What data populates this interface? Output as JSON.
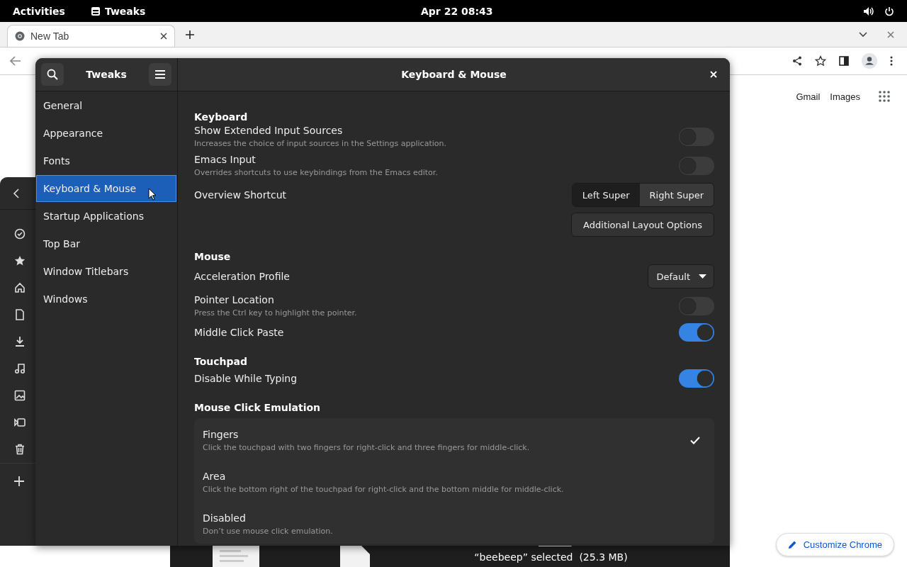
{
  "top_bar": {
    "activities": "Activities",
    "app": "Tweaks",
    "clock": "Apr 22  08:43"
  },
  "browser": {
    "tabs": [
      {
        "label": "New Tab",
        "selected": true
      }
    ],
    "links": [
      "Gmail",
      "Images"
    ],
    "customize": "Customize Chrome"
  },
  "tweaks": {
    "title": "Tweaks",
    "page_title": "Keyboard & Mouse",
    "sidebar": [
      {
        "label": "General",
        "selected": false
      },
      {
        "label": "Appearance",
        "selected": false
      },
      {
        "label": "Fonts",
        "selected": false
      },
      {
        "label": "Keyboard & Mouse",
        "selected": true
      },
      {
        "label": "Startup Applications",
        "selected": false
      },
      {
        "label": "Top Bar",
        "selected": false
      },
      {
        "label": "Window Titlebars",
        "selected": false
      },
      {
        "label": "Windows",
        "selected": false
      }
    ],
    "sections": [
      {
        "heading": "Keyboard",
        "rows": [
          {
            "kind": "switch",
            "label": "Show Extended Input Sources",
            "description": "Increases the choice of input sources in the Settings application.",
            "on": false
          },
          {
            "kind": "switch",
            "label": "Emacs Input",
            "description": "Overrides shortcuts to use keybindings from the Emacs editor.",
            "on": false
          },
          {
            "kind": "segmented",
            "label": "Overview Shortcut",
            "options": [
              {
                "label": "Left Super",
                "selected": true
              },
              {
                "label": "Right Super",
                "selected": false
              }
            ]
          },
          {
            "kind": "button",
            "label": "Additional Layout Options"
          }
        ]
      },
      {
        "heading": "Mouse",
        "rows": [
          {
            "kind": "dropdown",
            "label": "Acceleration Profile",
            "value": "Default"
          },
          {
            "kind": "switch",
            "label": "Pointer Location",
            "description": "Press the Ctrl key to highlight the pointer.",
            "on": false
          },
          {
            "kind": "switch",
            "label": "Middle Click Paste",
            "on": true
          }
        ]
      },
      {
        "heading": "Touchpad",
        "rows": [
          {
            "kind": "switch",
            "label": "Disable While Typing",
            "on": true
          }
        ]
      },
      {
        "heading": "Mouse Click Emulation",
        "rows": [
          {
            "kind": "choices",
            "options": [
              {
                "label": "Fingers",
                "description": "Click the touchpad with two fingers for right-click and three fingers for middle-click.",
                "selected": true
              },
              {
                "label": "Area",
                "description": "Click the bottom right of the touchpad for right-click and the bottom middle for middle-click.",
                "selected": false
              },
              {
                "label": "Disabled",
                "description": "Don’t use mouse click emulation.",
                "selected": false
              }
            ]
          }
        ]
      }
    ]
  },
  "status_toast": "“beebeep” selected  (25.3 MB)"
}
